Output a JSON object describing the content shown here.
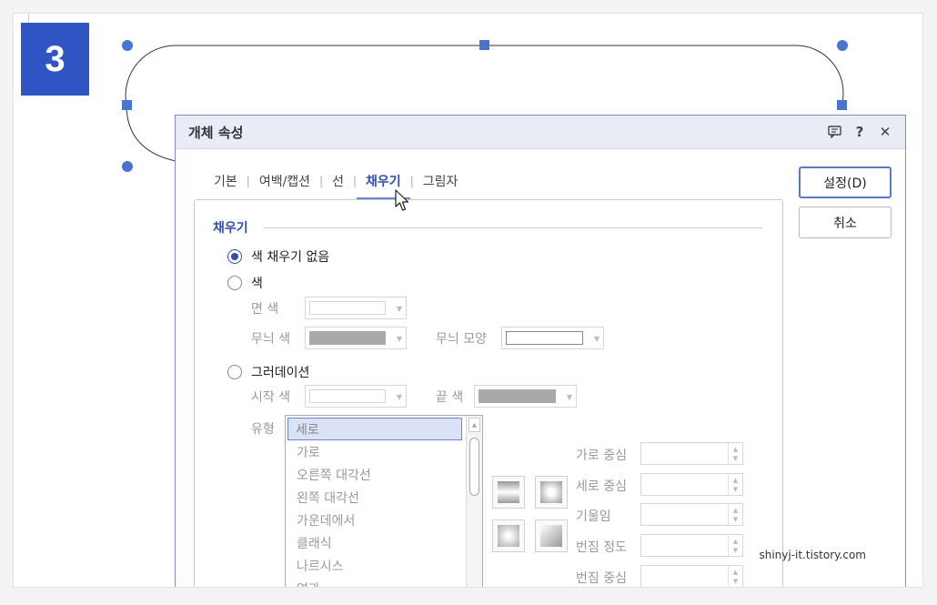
{
  "step_badge": "3",
  "dialog": {
    "title": "개체 속성",
    "icons": [
      "comment-icon",
      "help-icon",
      "close-icon"
    ],
    "help_glyph": "?",
    "close_glyph": "✕"
  },
  "tabs": [
    {
      "label": "기본",
      "active": false
    },
    {
      "label": "여백/캡션",
      "active": false
    },
    {
      "label": "선",
      "active": false
    },
    {
      "label": "채우기",
      "active": true
    },
    {
      "label": "그림자",
      "active": false
    }
  ],
  "tab_separator": "|",
  "fill": {
    "group_label": "채우기",
    "option_none": "색 채우기 없음",
    "option_color": "색",
    "option_gradient": "그러데이션",
    "selected_option": "none",
    "face_color_label": "면 색",
    "pattern_color_label": "무늬 색",
    "pattern_shape_label": "무늬 모양",
    "start_color_label": "시작 색",
    "end_color_label": "끝 색",
    "type_label": "유형",
    "type_options": [
      "세로",
      "가로",
      "오른쪽 대각선",
      "왼쪽 대각선",
      "가운데에서",
      "클래식",
      "나르시스",
      "연과"
    ],
    "type_selected": "세로",
    "h_center_label": "가로 중심",
    "v_center_label": "세로 중심",
    "tilt_label": "기울임",
    "blur_level_label": "번짐 정도",
    "blur_center_label": "번짐 중심"
  },
  "buttons": {
    "ok": "설정(D)",
    "cancel": "취소"
  },
  "colors": {
    "accent": "#2f4fb0",
    "badge": "#2f54c4",
    "handle": "#4a74d0",
    "pattern_swatch": "#a9a9a9"
  },
  "watermark": "shinyj-it.tistory.com"
}
